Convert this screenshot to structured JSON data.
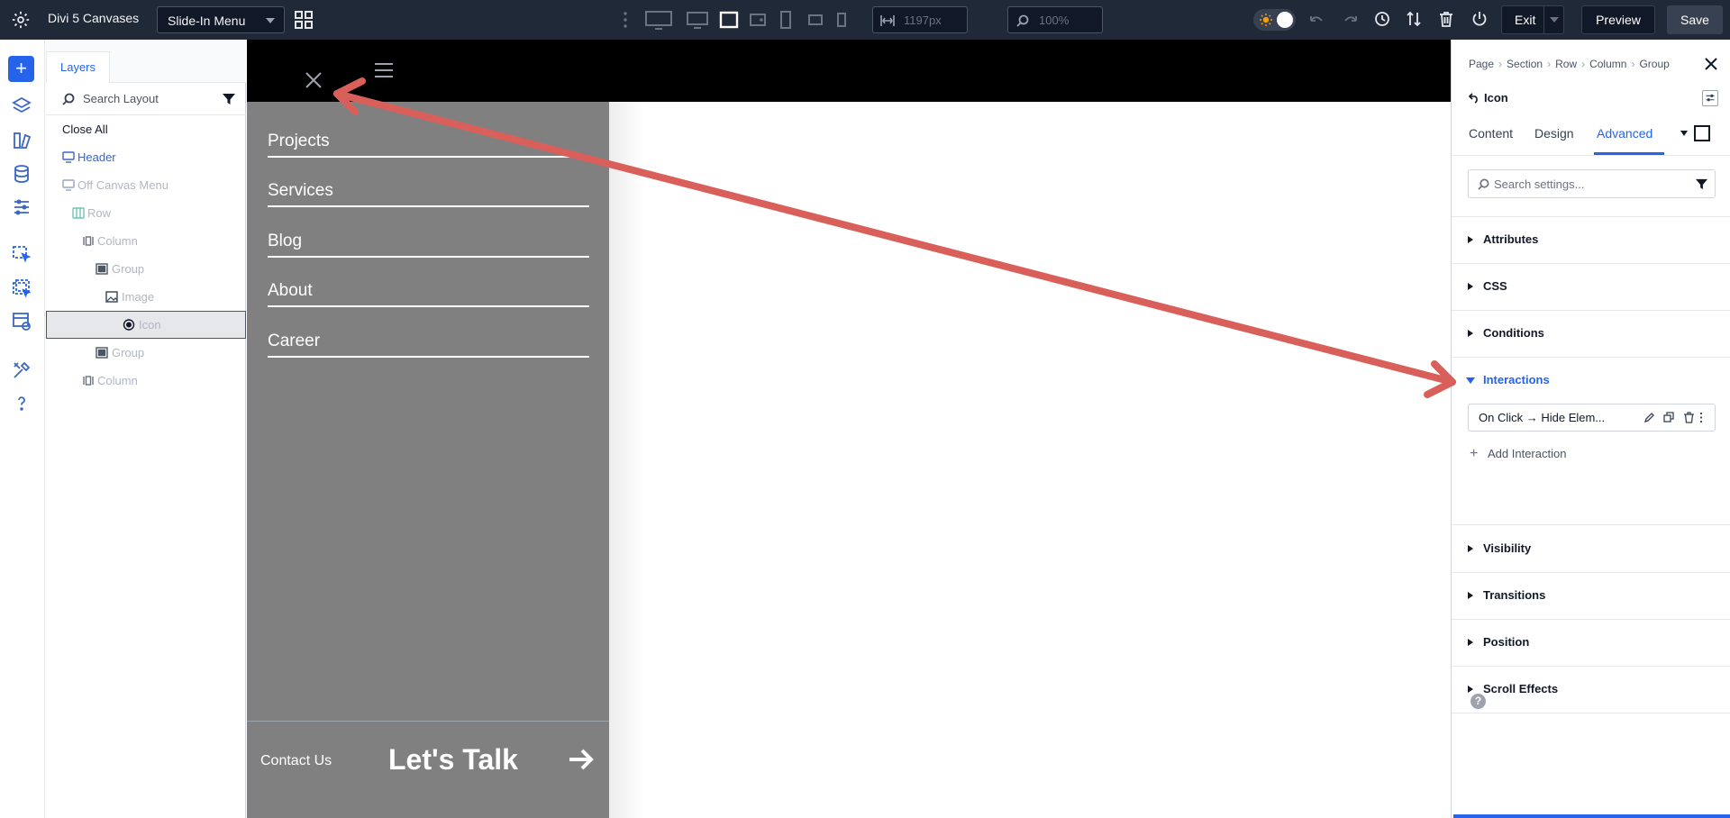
{
  "topbar": {
    "app_title": "Divi 5 Canvases",
    "canvas_select": "Slide-In Menu",
    "width_value": "1197px",
    "zoom_value": "100%",
    "exit_label": "Exit",
    "preview_label": "Preview",
    "save_label": "Save"
  },
  "layers": {
    "tab_label": "Layers",
    "search_placeholder": "Search Layout",
    "close_all": "Close All",
    "items": [
      {
        "label": "Header",
        "icon": "section-icon",
        "color": "#3b66c4"
      },
      {
        "label": "Off Canvas Menu",
        "icon": "section-icon",
        "color": "#b0b7c3"
      },
      {
        "label": "Row",
        "icon": "row-icon",
        "color": "#b0b7c3"
      },
      {
        "label": "Column",
        "icon": "column-icon",
        "color": "#b0b7c3"
      },
      {
        "label": "Group",
        "icon": "group-icon",
        "color": "#b0b7c3"
      },
      {
        "label": "Image",
        "icon": "image-icon",
        "color": "#b0b7c3"
      },
      {
        "label": "Icon",
        "icon": "icon-module-icon",
        "color": "#b0b7c3"
      },
      {
        "label": "Group",
        "icon": "group-icon",
        "color": "#b0b7c3"
      },
      {
        "label": "Column",
        "icon": "column-icon",
        "color": "#b0b7c3"
      }
    ]
  },
  "canvas": {
    "menu_items": [
      "Projects",
      "Services",
      "Blog",
      "About",
      "Career"
    ],
    "contact_label": "Contact Us",
    "cta_label": "Let's Talk",
    "menu_bg": "#808080"
  },
  "settings": {
    "breadcrumb": [
      "Page",
      "Section",
      "Row",
      "Column",
      "Group"
    ],
    "module_name": "Icon",
    "tabs": [
      "Content",
      "Design",
      "Advanced"
    ],
    "active_tab": "Advanced",
    "search_placeholder": "Search settings...",
    "sections": [
      "Attributes",
      "CSS",
      "Conditions",
      "Interactions",
      "Visibility",
      "Transitions",
      "Position",
      "Scroll Effects"
    ],
    "open_section": "Interactions",
    "interaction_item": "On Click → Hide Elem...",
    "add_interaction": "Add Interaction",
    "help_glyph": "?"
  },
  "colors": {
    "accent": "#2563eb",
    "topbar_bg": "#1f2937",
    "annotation_arrow": "#d9605a"
  }
}
